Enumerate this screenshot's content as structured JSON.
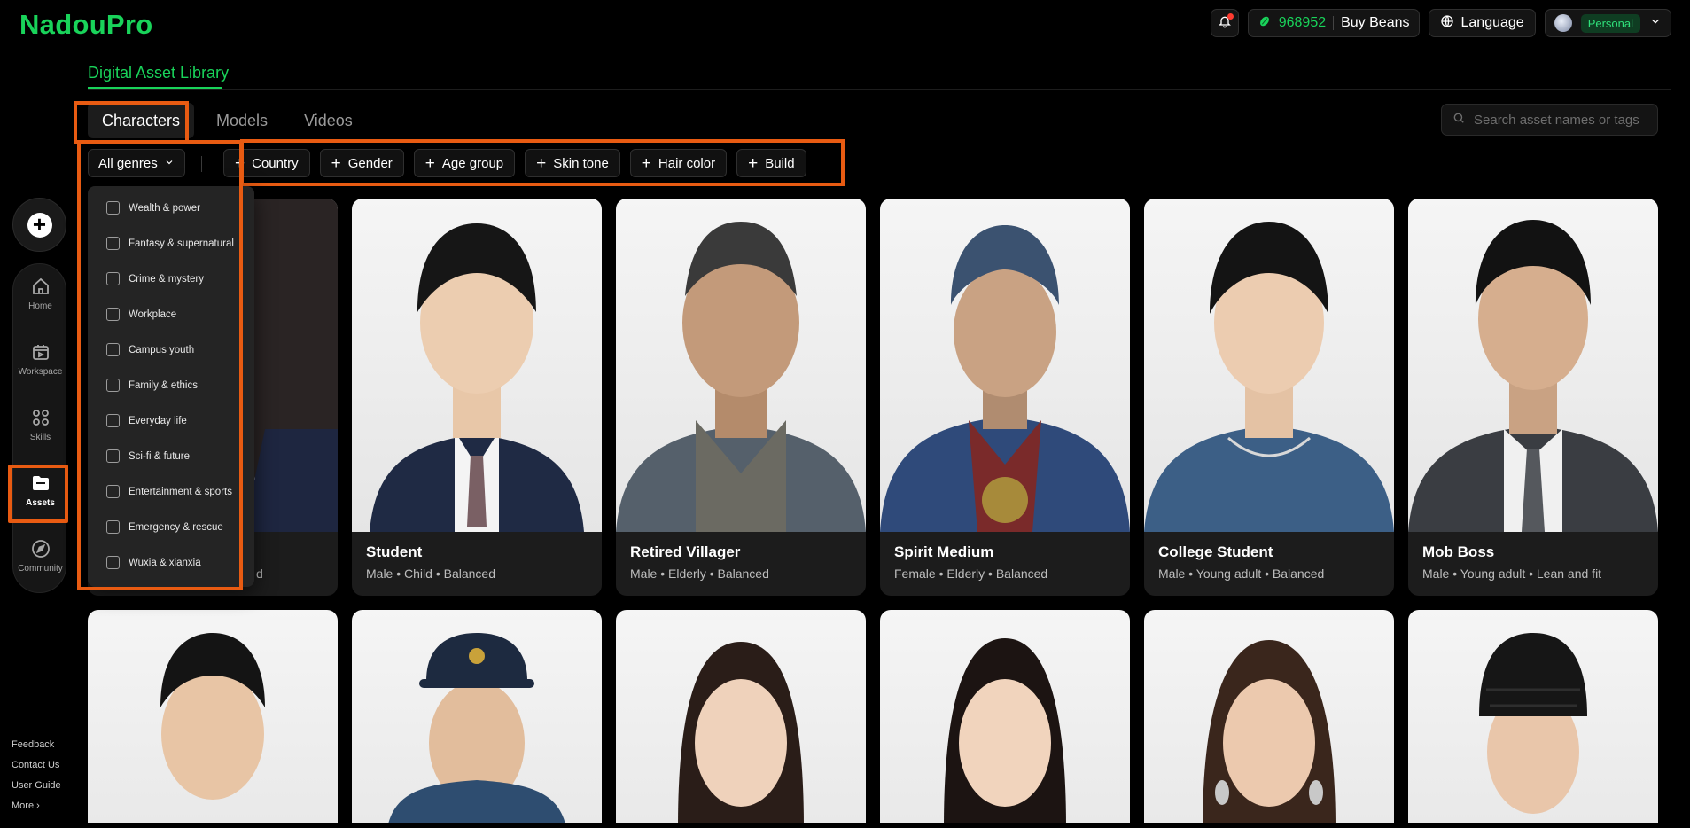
{
  "app": {
    "logo": "NadouPro"
  },
  "header": {
    "beans_count": "968952",
    "buy_beans": "Buy Beans",
    "language": "Language",
    "account_badge": "Personal"
  },
  "library": {
    "title": "Digital Asset Library"
  },
  "tabs": [
    {
      "label": "Characters"
    },
    {
      "label": "Models"
    },
    {
      "label": "Videos"
    }
  ],
  "search": {
    "placeholder": "Search asset names or tags"
  },
  "filters": {
    "genre_button": "All genres",
    "chips": [
      {
        "label": "Country"
      },
      {
        "label": "Gender"
      },
      {
        "label": "Age group"
      },
      {
        "label": "Skin tone"
      },
      {
        "label": "Hair color"
      },
      {
        "label": "Build"
      }
    ]
  },
  "genre_options": [
    {
      "label": "Wealth & power"
    },
    {
      "label": "Fantasy & supernatural"
    },
    {
      "label": "Crime & mystery"
    },
    {
      "label": "Workplace"
    },
    {
      "label": "Campus youth"
    },
    {
      "label": "Family & ethics"
    },
    {
      "label": "Everyday life"
    },
    {
      "label": "Sci-fi & future"
    },
    {
      "label": "Entertainment & sports"
    },
    {
      "label": "Emergency & rescue"
    },
    {
      "label": "Wuxia & xianxia"
    }
  ],
  "sidebar": {
    "items": [
      {
        "label": "Home"
      },
      {
        "label": "Workspace"
      },
      {
        "label": "Skills"
      },
      {
        "label": "Assets"
      },
      {
        "label": "Community"
      }
    ],
    "footer": [
      {
        "label": "Feedback"
      },
      {
        "label": "Contact Us"
      },
      {
        "label": "User Guide"
      },
      {
        "label": "More ›"
      }
    ]
  },
  "cards": [
    {
      "name": "",
      "meta": "d"
    },
    {
      "name": "Student",
      "meta": "Male  •  Child  •  Balanced"
    },
    {
      "name": "Retired Villager",
      "meta": "Male  •  Elderly  •  Balanced"
    },
    {
      "name": "Spirit Medium",
      "meta": "Female  •  Elderly  •  Balanced"
    },
    {
      "name": "College Student",
      "meta": "Male  •  Young adult  •  Balanced"
    },
    {
      "name": "Mob Boss",
      "meta": "Male  •  Young adult  •  Lean and fit"
    }
  ],
  "colors": {
    "accent": "#19d35a",
    "highlight": "#e85b12"
  }
}
